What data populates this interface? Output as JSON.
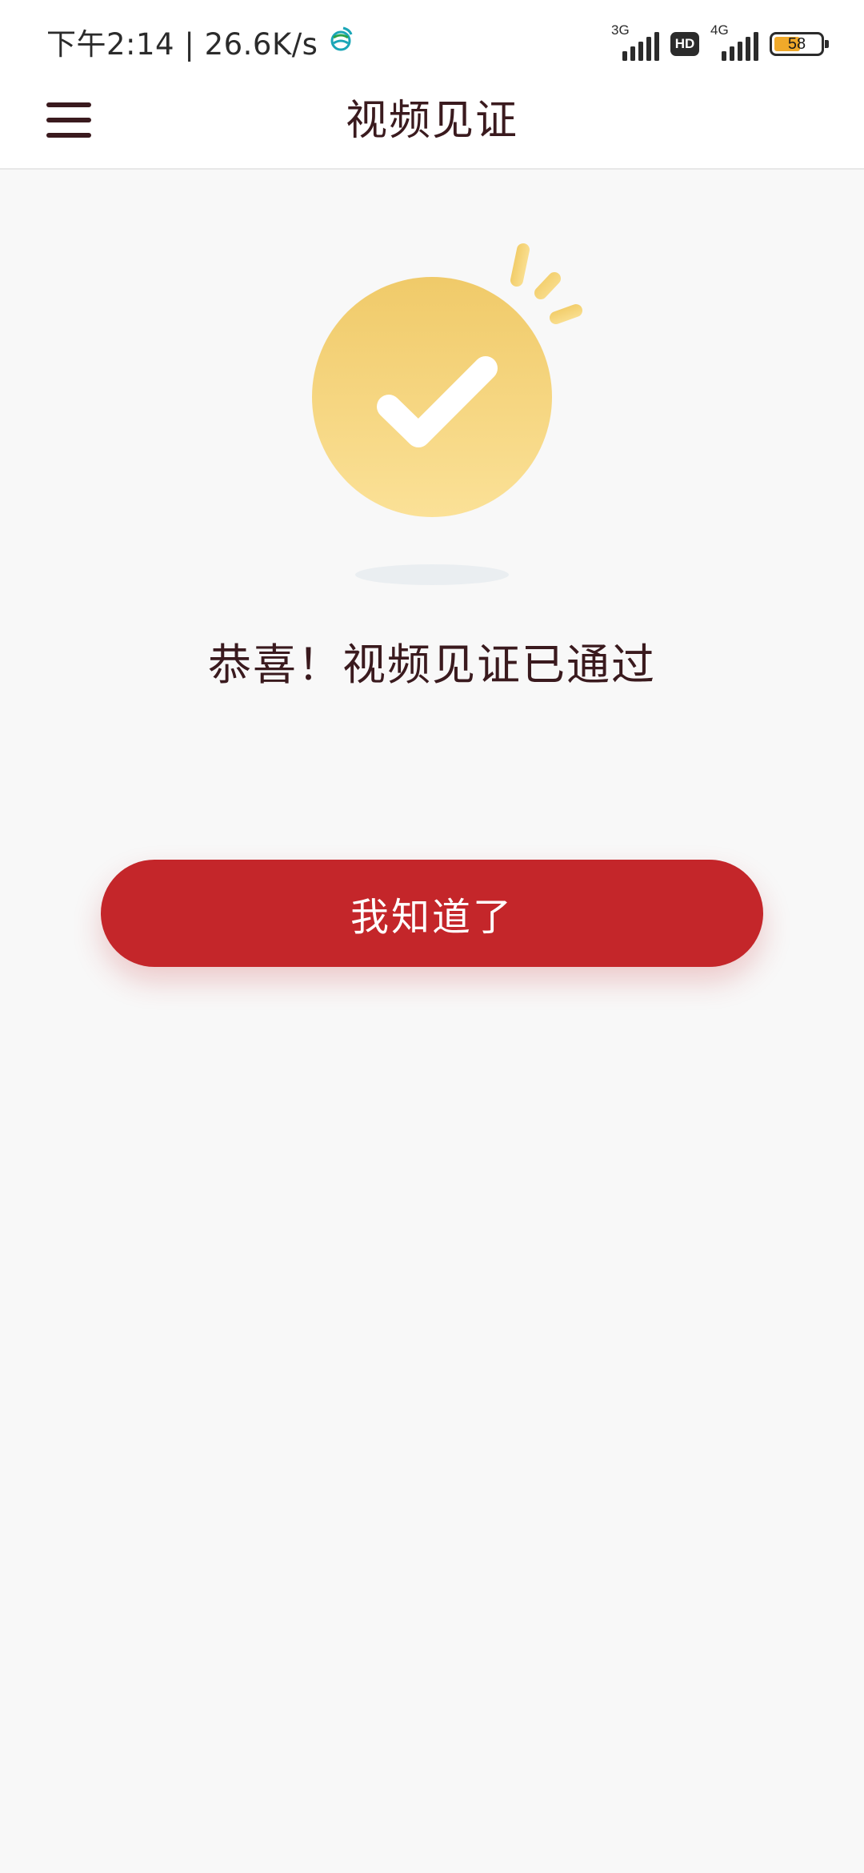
{
  "status_bar": {
    "time_speed": "下午2:14 | 26.6K/s",
    "net1_label": "3G",
    "hd_label": "HD",
    "net2_label": "4G",
    "battery_level": "58",
    "battery_fraction": 0.58,
    "battery_color": "#f0a92a"
  },
  "header": {
    "title": "视频见证"
  },
  "main": {
    "message": "恭喜！视频见证已通过",
    "confirm_label": "我知道了"
  },
  "colors": {
    "accent": "#c4262a",
    "text": "#3a1a1e",
    "background": "#f8f8f8",
    "badge_gold_top": "#f0ca69",
    "badge_gold_bottom": "#fbe197"
  },
  "icons": {
    "menu": "hamburger-menu-icon",
    "success": "checkmark-badge-icon",
    "carrier": "carrier-globe-icon"
  }
}
